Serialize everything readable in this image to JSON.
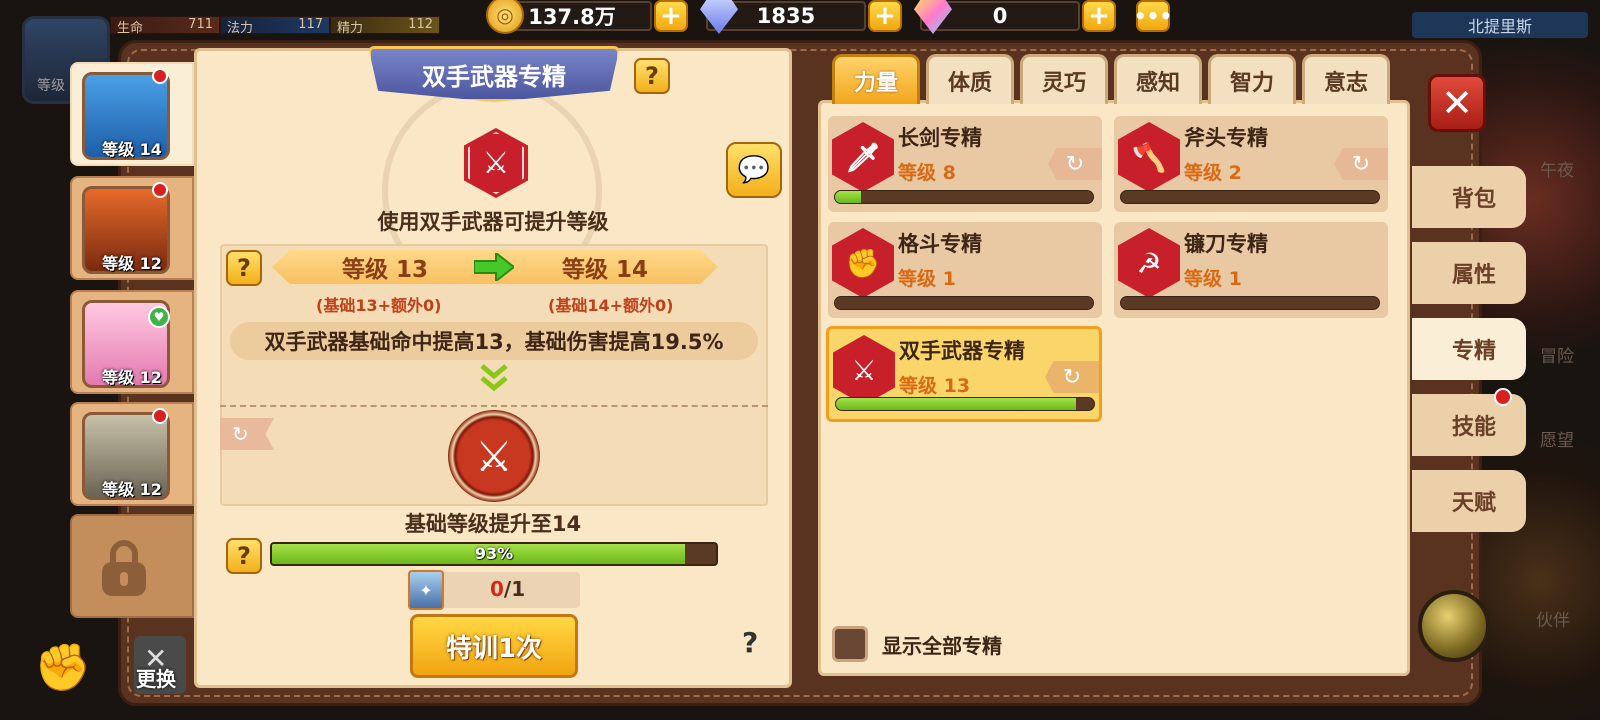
{
  "top_stats": {
    "hp_label": "生命",
    "hp_value": "711",
    "mp_label": "法力",
    "mp_value": "117",
    "sp_label": "精力",
    "sp_value": "112"
  },
  "resources": {
    "coins": "137.8万",
    "diamonds": "1835",
    "crystals": "0",
    "more_icon": "ellipsis-icon"
  },
  "region_name": "北提里斯",
  "top_avatar_label": "等级",
  "heroes": [
    {
      "level_label": "等级 14",
      "active": true
    },
    {
      "level_label": "等级 12"
    },
    {
      "level_label": "等级 12"
    },
    {
      "level_label": "等级 12"
    }
  ],
  "swap_label": "更换",
  "detail": {
    "title": "双手武器专精",
    "subtitle": "使用双手武器可提升等级",
    "level_from": "等级 13",
    "level_to": "等级 14",
    "note_from": "(基础13+额外0)",
    "note_to": "(基础14+额外0)",
    "effect": "双手武器基础命中提高13，基础伤害提高19.5%",
    "base_upgrade": "基础等级提升至14",
    "progress": 0.93,
    "progress_text": "93%",
    "item_have": "0",
    "item_need": "/1",
    "train_button": "特训1次",
    "help_mark": "?"
  },
  "attribute_tabs": [
    "力量",
    "体质",
    "灵巧",
    "感知",
    "智力",
    "意志"
  ],
  "specializations": [
    {
      "name": "长剑专精",
      "level": "等级 8",
      "progress": 0.1,
      "icon": "sword-icon",
      "refresh": true
    },
    {
      "name": "斧头专精",
      "level": "等级 2",
      "progress": 0.0,
      "icon": "axe-icon",
      "refresh": true
    },
    {
      "name": "格斗专精",
      "level": "等级 1",
      "progress": 0.0,
      "icon": "fist-icon",
      "refresh": false
    },
    {
      "name": "镰刀专精",
      "level": "等级 1",
      "progress": 0.0,
      "icon": "scythe-icon",
      "refresh": false
    },
    {
      "name": "双手武器专精",
      "level": "等级 13",
      "progress": 0.93,
      "icon": "two-hand-weapon-icon",
      "refresh": true,
      "active": true
    }
  ],
  "show_all_label": "显示全部专精",
  "side_tabs": [
    {
      "label": "背包"
    },
    {
      "label": "属性"
    },
    {
      "label": "专精",
      "active": true
    },
    {
      "label": "技能",
      "badge": true
    },
    {
      "label": "天赋"
    }
  ],
  "bg_labels": {
    "night": "午夜",
    "adventure": "冒险",
    "hope": "愿望",
    "partner": "伙伴"
  }
}
